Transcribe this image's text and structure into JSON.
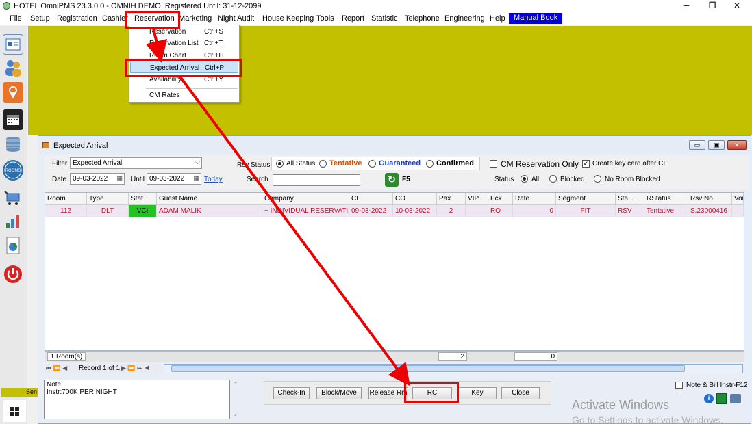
{
  "app": {
    "title": "HOTEL OmniPMS 23.3.0.0 - OMNIH DEMO, Registered Until: 31-12-2099",
    "window_buttons": [
      "─",
      "❐",
      "✕"
    ]
  },
  "menu": {
    "items": [
      "File",
      "Setup",
      "Registration",
      "Cashier",
      "Reservation",
      "Marketing",
      "Night Audit",
      "House Keeping",
      "Tools",
      "Report",
      "Statistic",
      "Telephone",
      "Engineering",
      "Help"
    ],
    "manual_book": "Manual Book"
  },
  "sidebar": {
    "icons": [
      "registration-card-icon",
      "guests-icon",
      "map-pin-icon",
      "calendar-icon",
      "database-icon",
      "rooms-available-icon",
      "cart-icon",
      "chart-icon",
      "report-icon",
      "power-icon"
    ],
    "rooms_label": "ROOMS"
  },
  "dropdown": {
    "items": [
      {
        "label": "Reservation",
        "shortcut": "Ctrl+S"
      },
      {
        "label": "Reservation List",
        "shortcut": "Ctrl+T"
      },
      {
        "label": "Room Chart",
        "shortcut": "Ctrl+H"
      },
      {
        "label": "Expected Arrival",
        "shortcut": "Ctrl+P"
      },
      {
        "label": "Availability",
        "shortcut": "Ctrl+Y"
      },
      {
        "label": "CM Rates",
        "shortcut": ""
      }
    ]
  },
  "window": {
    "title": "Expected Arrival",
    "buttons": [
      "▭",
      "▣",
      "✕"
    ]
  },
  "filters": {
    "filter_label": "Filter",
    "filter_value": "Expected Arrival",
    "date_label": "Date",
    "date_value": "09-03-2022",
    "until_label": "Until",
    "until_value": "09-03-2022",
    "today_link": "Today",
    "rsv_status_label": "Rsv Status",
    "rsv_options": [
      "All Status",
      "Tentative",
      "Guaranteed",
      "Confirmed"
    ],
    "search_label": "Search",
    "search_value": "",
    "refresh_key": "F5",
    "cm_only_label": "CM Reservation Only",
    "create_key_label": "Create key card after CI",
    "status_label": "Status",
    "status_options": [
      "All",
      "Blocked",
      "No Room Blocked"
    ]
  },
  "grid": {
    "columns": [
      "Room",
      "Type",
      "Stat",
      "Guest Name",
      "Company",
      "CI",
      "CO",
      "Pax",
      "VIP",
      "Pck",
      "Rate",
      "Segment",
      "Sta...",
      "RStatus",
      "Rsv No",
      "Vou"
    ],
    "rows": [
      [
        "112",
        "DLT",
        "VCI",
        "ADAM MALIK",
        "~ INDIVIDUAL RESERVATI...",
        "09-03-2022",
        "10-03-2022",
        "2",
        "",
        "RO",
        "0",
        "FIT",
        "RSV",
        "Tentative",
        "S.23000416",
        ""
      ]
    ],
    "footer": {
      "rooms": "1 Room(s)",
      "pax_total": "2",
      "rate_total": "0"
    },
    "navigator": {
      "record": "Record 1 of 1"
    }
  },
  "note": {
    "label": "Note:",
    "text": "Instr:700K PER NIGHT"
  },
  "buttons": [
    "Check-In",
    "Block/Move",
    "Release Rm",
    "RC",
    "Key",
    "Close"
  ],
  "note_bill_label": "Note & Bill Instr-F12",
  "watermark": {
    "line1": "Activate Windows",
    "line2": "Go to Settings to activate Windows."
  },
  "taskbar": {
    "tile_label": "Sen"
  }
}
